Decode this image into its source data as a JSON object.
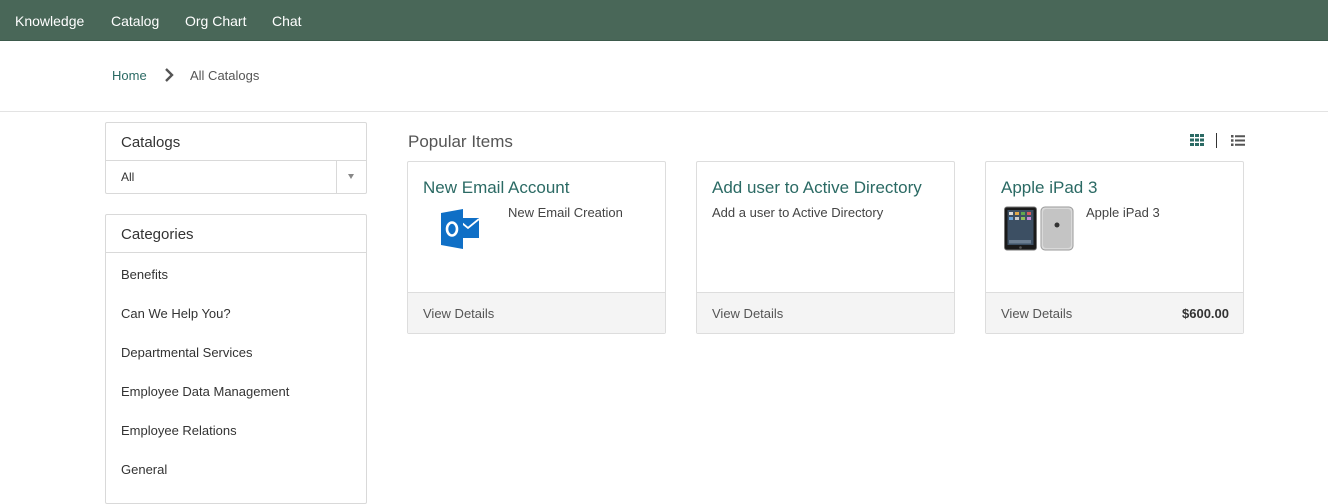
{
  "nav": {
    "items": [
      "Knowledge",
      "Catalog",
      "Org Chart",
      "Chat"
    ]
  },
  "breadcrumb": {
    "home": "Home",
    "current": "All Catalogs"
  },
  "catalogs": {
    "title": "Catalogs",
    "selected": "All"
  },
  "categories": {
    "title": "Categories",
    "items": [
      "Benefits",
      "Can We Help You?",
      "Departmental Services",
      "Employee Data Management",
      "Employee Relations",
      "General"
    ]
  },
  "popular": {
    "title": "Popular Items",
    "view_details_label": "View Details",
    "items": [
      {
        "title": "New Email Account",
        "description": "New Email Creation",
        "icon": "outlook-icon",
        "price": ""
      },
      {
        "title": "Add user to Active Directory",
        "description": "Add a user to Active Directory",
        "icon": "",
        "price": ""
      },
      {
        "title": "Apple iPad 3",
        "description": "Apple iPad 3",
        "icon": "ipad-image",
        "price": "$600.00"
      }
    ]
  },
  "colors": {
    "nav_bg": "#496758",
    "link": "#2b6a64",
    "outlook_blue": "#0f6fc6"
  }
}
